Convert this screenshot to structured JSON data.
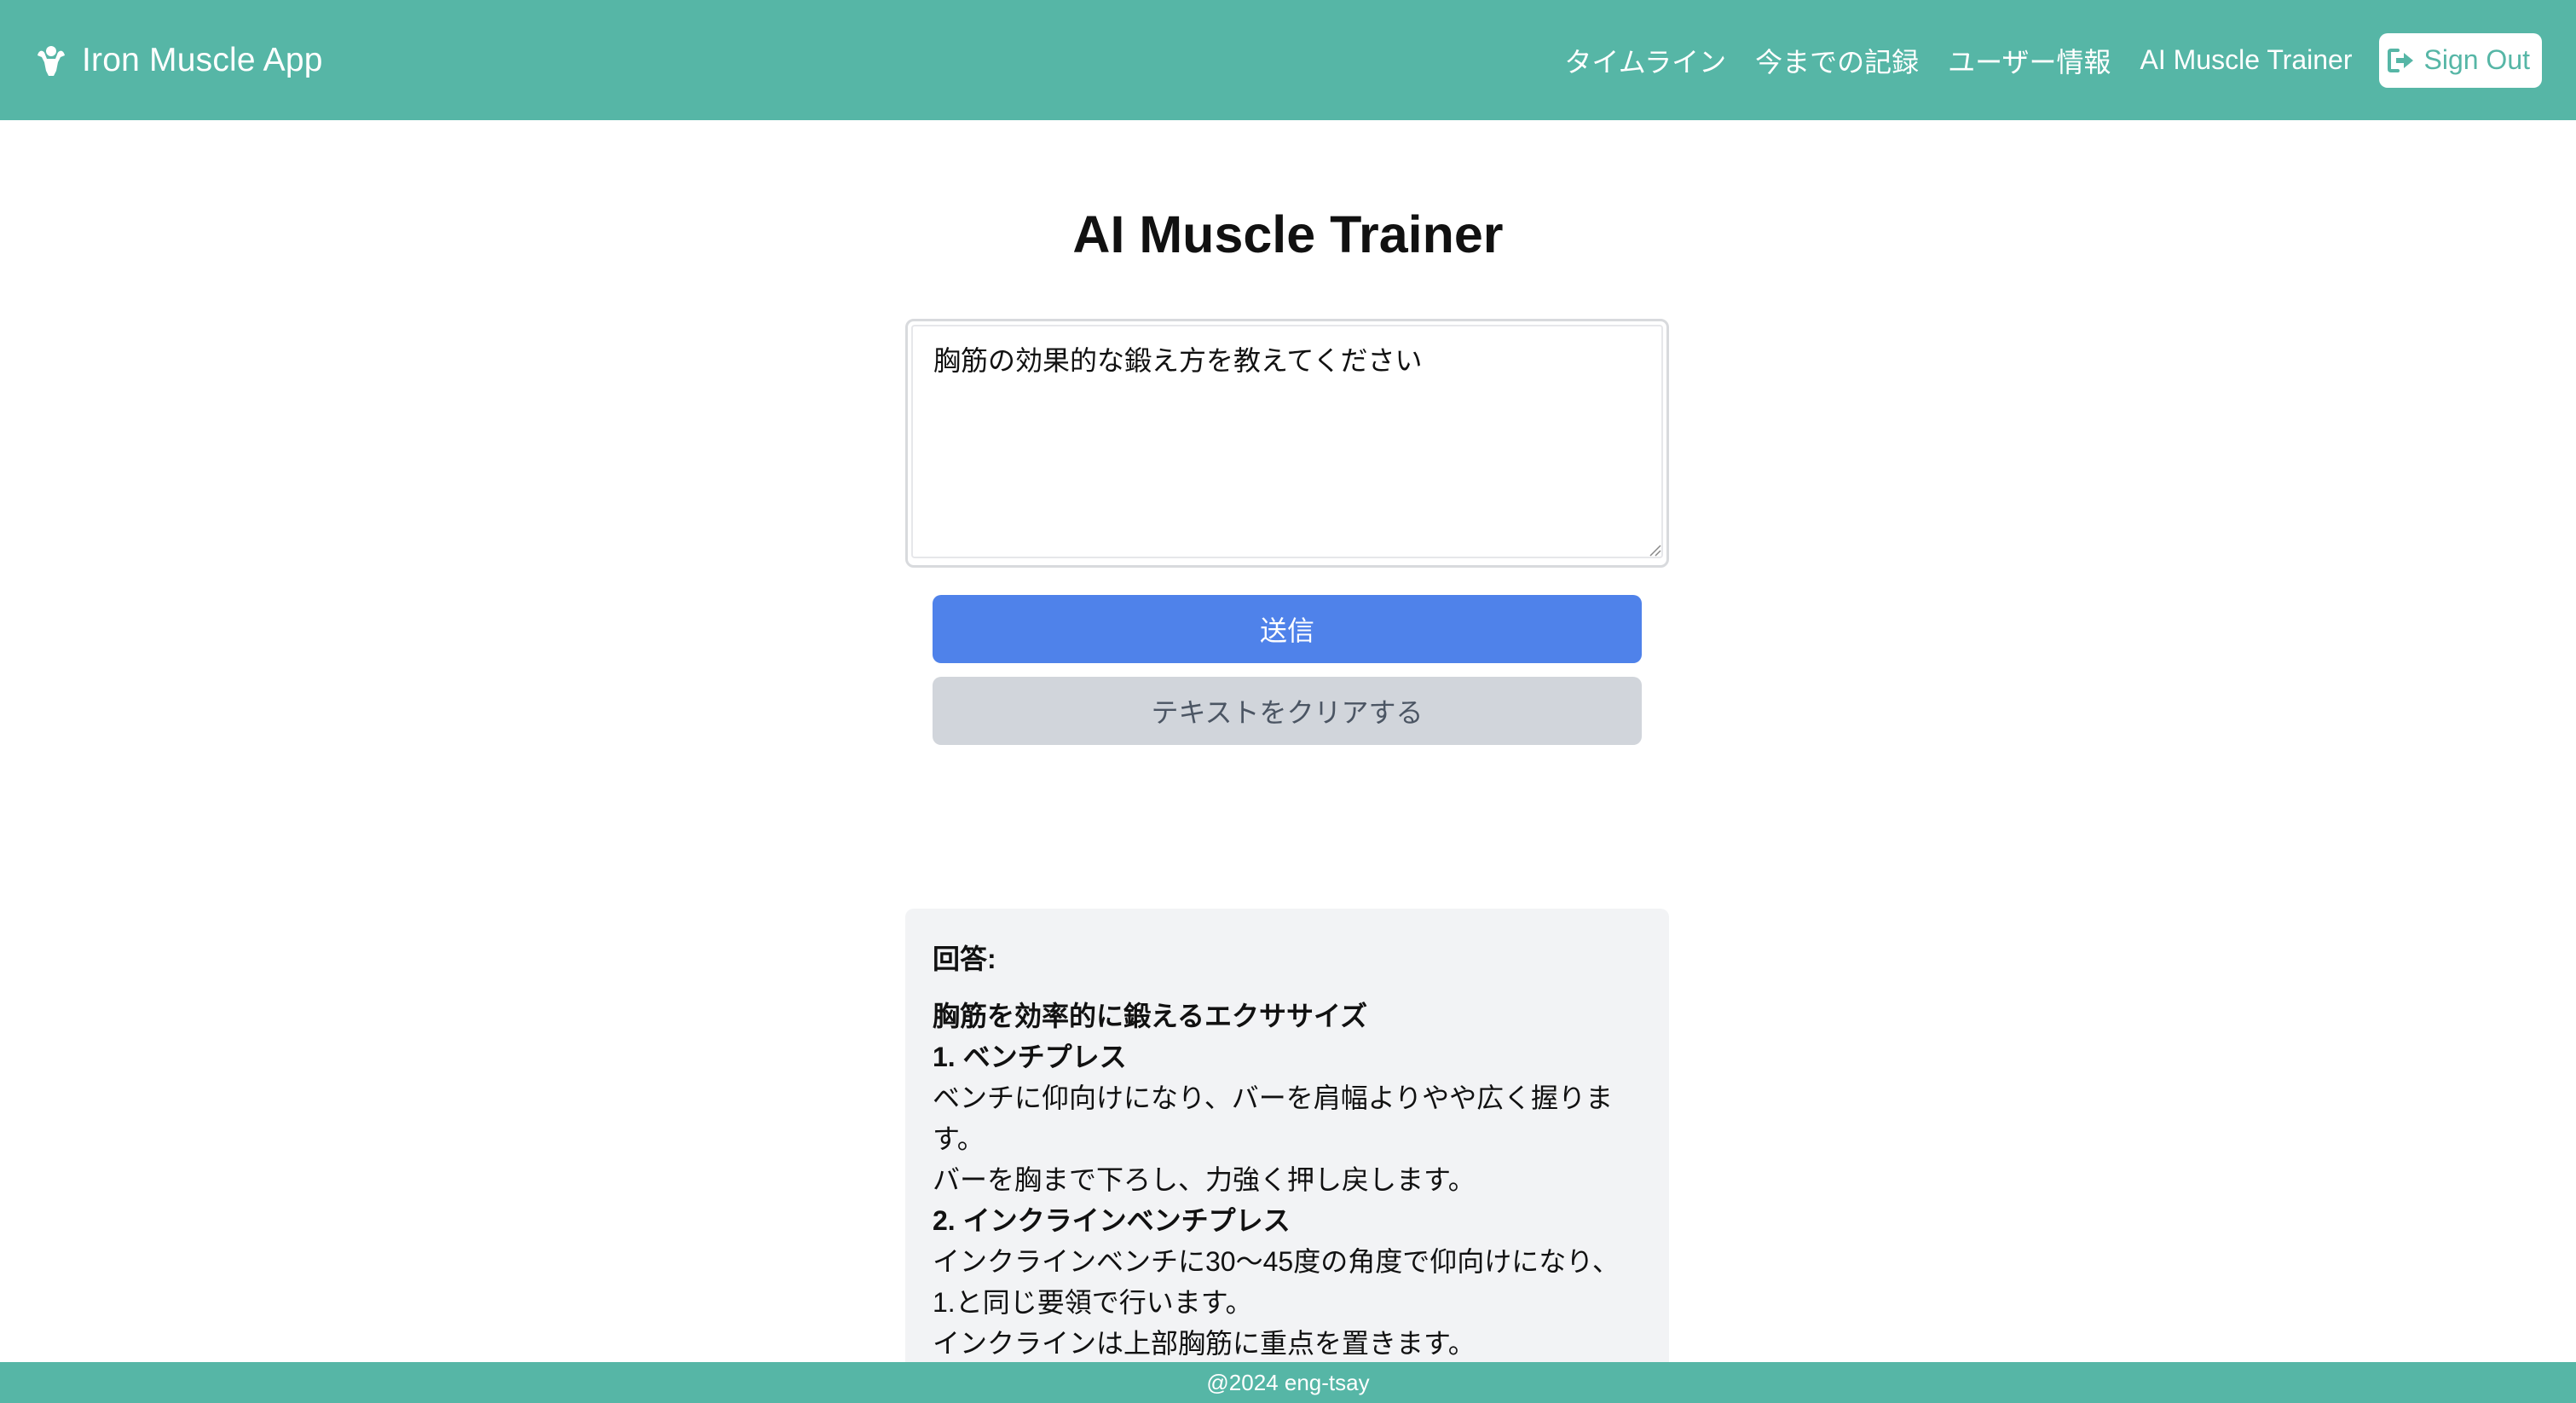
{
  "header": {
    "brand": "Iron Muscle App",
    "brand_icon": "muscle-icon",
    "nav": {
      "timeline": "タイムライン",
      "records": "今までの記録",
      "user_info": "ユーザー情報",
      "ai_trainer": "AI Muscle Trainer"
    },
    "signout_label": "Sign Out",
    "signout_icon": "sign-out-icon"
  },
  "main": {
    "title": "AI Muscle Trainer",
    "input_value": "胸筋の効果的な鍛え方を教えてください",
    "send_label": "送信",
    "clear_label": "テキストをクリアする"
  },
  "answer": {
    "label": "回答:",
    "lines": [
      "胸筋を効率的に鍛えるエクササイズ",
      "1. ベンチプレス",
      "ベンチに仰向けになり、バーを肩幅よりやや広く握りま",
      "す。",
      "バーを胸まで下ろし、力強く押し戻します。",
      "2. インクラインベンチプレス",
      "インクラインベンチに30〜45度の角度で仰向けになり、",
      "1.と同じ要領で行います。",
      "インクラインは上部胸筋に重点を置きます。"
    ]
  },
  "footer": {
    "text": "@2024 eng-tsay"
  },
  "colors": {
    "primary": "#56b6a6",
    "send_button": "#4f82ea",
    "clear_button": "#d1d5db",
    "answer_bg": "#f2f3f5"
  }
}
